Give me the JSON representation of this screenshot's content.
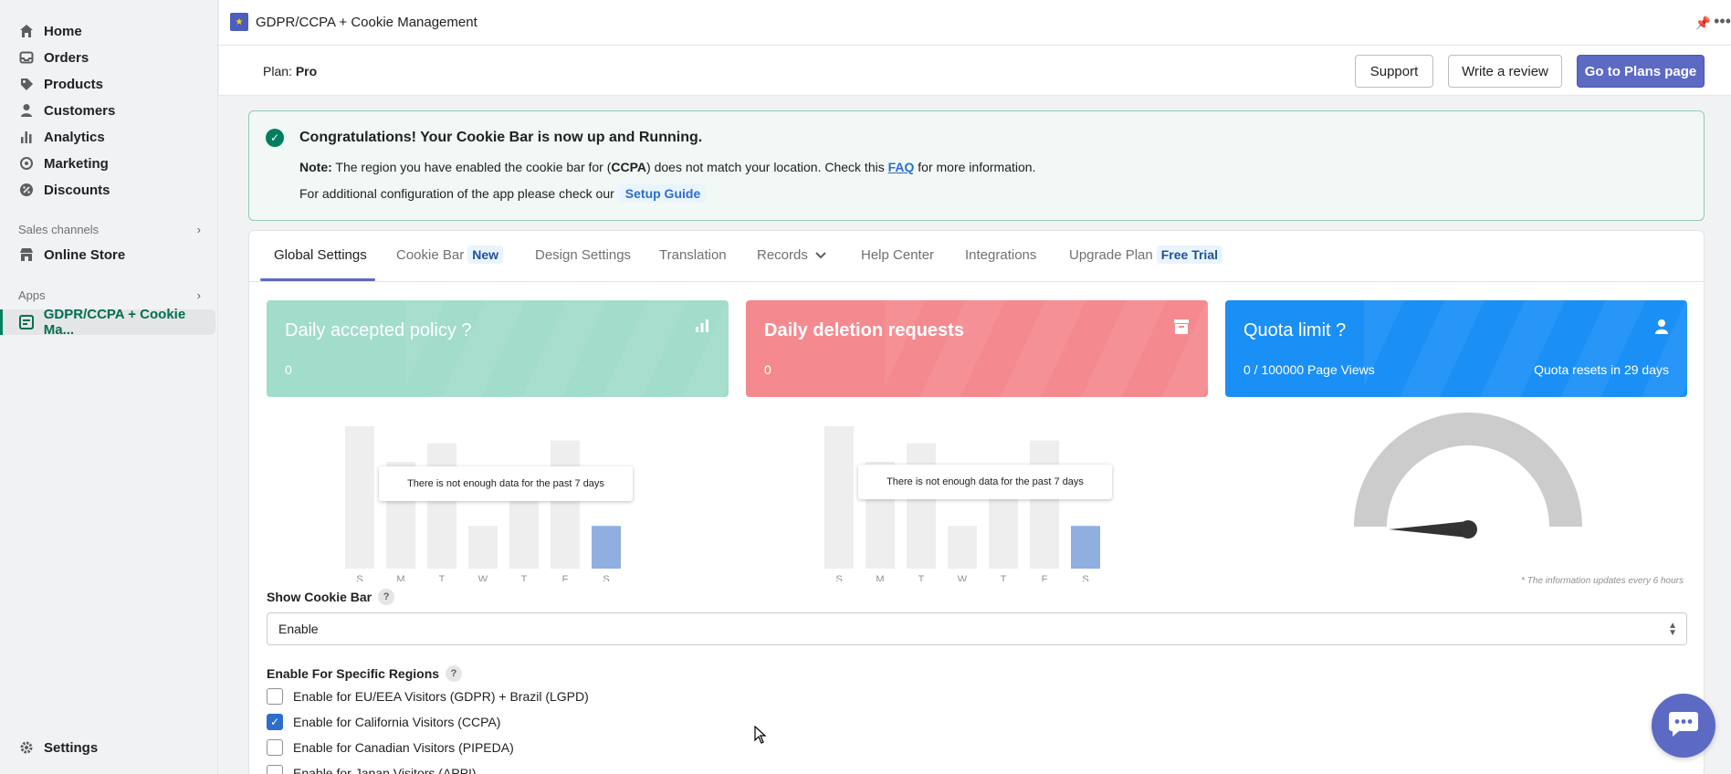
{
  "sidebar": {
    "items": [
      {
        "label": "Home",
        "icon": "home-icon"
      },
      {
        "label": "Orders",
        "icon": "inbox-icon"
      },
      {
        "label": "Products",
        "icon": "tag-icon"
      },
      {
        "label": "Customers",
        "icon": "person-icon"
      },
      {
        "label": "Analytics",
        "icon": "bar-chart-icon"
      },
      {
        "label": "Marketing",
        "icon": "target-icon"
      },
      {
        "label": "Discounts",
        "icon": "discount-icon"
      }
    ],
    "sales_channels_label": "Sales channels",
    "online_store_label": "Online Store",
    "apps_label": "Apps",
    "active_app_label": "GDPR/CCPA + Cookie Ma...",
    "settings_label": "Settings"
  },
  "appbar": {
    "title": "GDPR/CCPA + Cookie Management"
  },
  "planbar": {
    "plan_prefix": "Plan: ",
    "plan_name": "Pro",
    "support_label": "Support",
    "review_label": "Write a review",
    "plans_label": "Go to Plans page"
  },
  "banner": {
    "title": "Congratulations! Your Cookie Bar is now up and Running.",
    "note_prefix": "Note:",
    "note_text_1": " The region you have enabled the cookie bar for (",
    "note_region": "CCPA",
    "note_text_2": ") does not match your location. Check this ",
    "note_link": "FAQ",
    "note_text_3": " for more information.",
    "config_text": "For additional configuration of the app please check our ",
    "config_link": "Setup Guide"
  },
  "tabs": [
    {
      "label": "Global Settings"
    },
    {
      "label": "Cookie Bar",
      "pill": "New"
    },
    {
      "label": "Design Settings"
    },
    {
      "label": "Translation"
    },
    {
      "label": "Records"
    },
    {
      "label": "Help Center"
    },
    {
      "label": "Integrations"
    },
    {
      "label": "Upgrade Plan",
      "pill": "Free Trial"
    }
  ],
  "stats": {
    "accepted": {
      "title": "Daily accepted policy ?",
      "value": "0",
      "color": "#a2dccb"
    },
    "deletion": {
      "title": "Daily deletion requests",
      "value": "0",
      "color": "#f48a8f"
    },
    "quota": {
      "title": "Quota limit ?",
      "value": "0 / 100000 Page Views",
      "reset": "Quota resets in 29 days",
      "color": "#1a8ff6"
    }
  },
  "chart_data": [
    {
      "type": "bar",
      "categories": [
        "S",
        "M",
        "T",
        "W",
        "T",
        "F",
        "S"
      ],
      "values": [
        100,
        75,
        88,
        30,
        62,
        90,
        30
      ],
      "message": "There is not enough data for the past 7 days"
    },
    {
      "type": "bar",
      "categories": [
        "S",
        "M",
        "T",
        "W",
        "T",
        "F",
        "S"
      ],
      "values": [
        100,
        75,
        88,
        30,
        62,
        90,
        30
      ],
      "message": "There is not enough data for the past 7 days"
    }
  ],
  "gauge": {
    "value": 0
  },
  "footnote": "* The information updates every 6 hours",
  "form": {
    "show_cookie_bar_label": "Show Cookie Bar",
    "show_cookie_bar_value": "Enable",
    "regions_label": "Enable For Specific Regions",
    "regions": [
      {
        "label": "Enable for EU/EEA Visitors (GDPR) + Brazil (LGPD)",
        "checked": false
      },
      {
        "label": "Enable for California Visitors (CCPA)",
        "checked": true
      },
      {
        "label": "Enable for Canadian Visitors (PIPEDA)",
        "checked": false
      },
      {
        "label": "Enable for Japan Visitors (APPI)",
        "checked": false
      }
    ]
  }
}
